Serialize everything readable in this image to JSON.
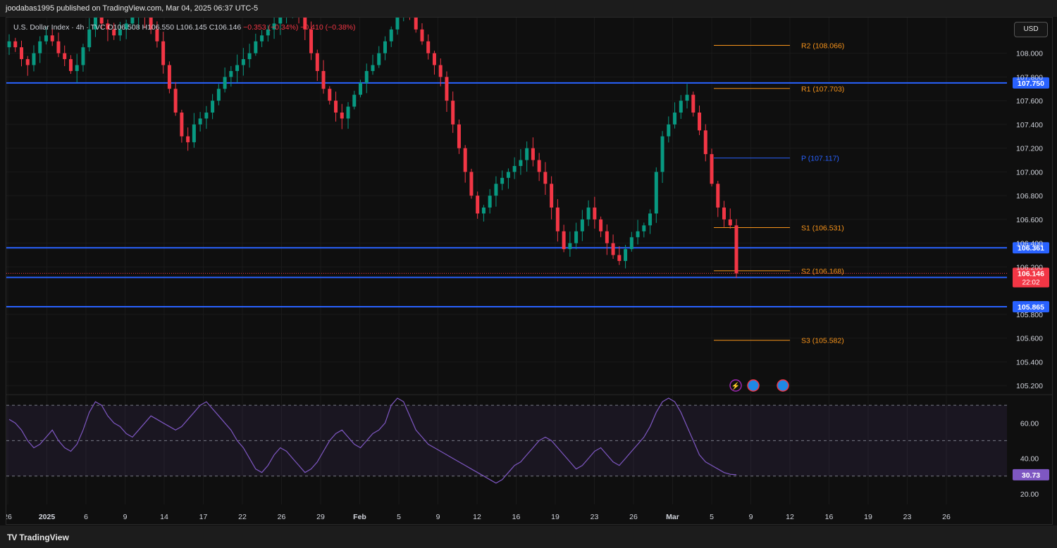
{
  "header": {
    "published": "joodabas1995 published on TradingView.com, Mar 04, 2025 06:37 UTC-5"
  },
  "legend": {
    "symbol": "U.S. Dollar Index · 4h · TVC",
    "o": "O106.508",
    "h": "H106.550",
    "l": "L106.145",
    "c": "C106.146",
    "change": "−0.353 (−0.34%)  −0.410 (−0.38%)"
  },
  "currency_button": "USD",
  "footer": {
    "logo_text": "TradingView"
  },
  "colors": {
    "up": "#089981",
    "down": "#f23645",
    "level": "#2962ff",
    "pivot_orange": "#f7931a",
    "pivot_blue": "#2962ff",
    "rsi": "#7e57c2"
  },
  "chart_data": {
    "type": "candlestick",
    "price_axis": {
      "ylim": [
        105.13,
        108.3
      ],
      "ticks": [
        "108.000",
        "107.800",
        "107.600",
        "107.400",
        "107.200",
        "107.000",
        "106.800",
        "106.600",
        "106.400",
        "106.200",
        "105.800",
        "105.600",
        "105.400",
        "105.200"
      ]
    },
    "x_ticks": [
      "26",
      "2025",
      "6",
      "9",
      "14",
      "17",
      "22",
      "26",
      "29",
      "Feb",
      "5",
      "9",
      "12",
      "16",
      "19",
      "23",
      "26",
      "Mar",
      "5",
      "9",
      "12",
      "16",
      "19",
      "23",
      "26"
    ],
    "last_price": {
      "value": "106.146",
      "countdown": "22:02"
    },
    "horizontal_levels": [
      {
        "value": 107.75,
        "label": "107.750"
      },
      {
        "value": 106.361,
        "label": "106.361"
      },
      {
        "value": 106.111,
        "label": "106.111"
      },
      {
        "value": 105.865,
        "label": "105.865"
      }
    ],
    "pivots": [
      {
        "name": "R2",
        "value": 108.066,
        "label": "R2 (108.066)"
      },
      {
        "name": "R1",
        "value": 107.703,
        "label": "R1 (107.703)"
      },
      {
        "name": "P",
        "value": 107.117,
        "label": "P (107.117)"
      },
      {
        "name": "S1",
        "value": 106.531,
        "label": "S1 (106.531)"
      },
      {
        "name": "S2",
        "value": 106.168,
        "label": "S2 (106.168)"
      },
      {
        "name": "S3",
        "value": 105.582,
        "label": "S3 (105.582)"
      }
    ],
    "closes_approx": [
      108.1,
      108.05,
      107.95,
      107.9,
      108.0,
      108.1,
      108.15,
      108.1,
      108.0,
      107.95,
      107.85,
      107.9,
      108.05,
      108.2,
      108.3,
      108.25,
      108.2,
      108.15,
      108.2,
      108.25,
      108.3,
      108.35,
      108.3,
      108.2,
      108.1,
      107.9,
      107.7,
      107.5,
      107.3,
      107.25,
      107.4,
      107.45,
      107.5,
      107.6,
      107.7,
      107.8,
      107.85,
      107.9,
      107.95,
      108.0,
      108.1,
      108.15,
      108.2,
      108.25,
      108.3,
      108.35,
      108.4,
      108.35,
      108.2,
      108.0,
      107.85,
      107.7,
      107.6,
      107.5,
      107.45,
      107.55,
      107.65,
      107.75,
      107.85,
      107.9,
      108.0,
      108.1,
      108.2,
      108.3,
      108.35,
      108.3,
      108.2,
      108.1,
      108.0,
      107.9,
      107.8,
      107.6,
      107.4,
      107.2,
      107.0,
      106.8,
      106.65,
      106.7,
      106.8,
      106.9,
      106.95,
      107.0,
      107.05,
      107.1,
      107.2,
      107.1,
      107.0,
      106.9,
      106.7,
      106.5,
      106.35,
      106.4,
      106.5,
      106.6,
      106.7,
      106.6,
      106.5,
      106.4,
      106.3,
      106.25,
      106.35,
      106.45,
      106.5,
      106.55,
      106.65,
      107.0,
      107.3,
      107.4,
      107.5,
      107.6,
      107.65,
      107.5,
      107.35,
      107.15,
      106.9,
      106.7,
      106.6,
      106.55,
      106.146
    ],
    "rsi": {
      "label": "30.73",
      "value": 30.73,
      "ylim": [
        14,
        76
      ],
      "ticks": [
        "60.00",
        "40.00",
        "20.00"
      ],
      "bands": [
        70,
        50,
        30
      ],
      "values_approx": [
        62,
        60,
        56,
        50,
        46,
        48,
        52,
        56,
        50,
        46,
        44,
        48,
        56,
        66,
        72,
        70,
        64,
        60,
        58,
        54,
        52,
        56,
        60,
        64,
        62,
        60,
        58,
        56,
        58,
        62,
        66,
        70,
        72,
        68,
        64,
        60,
        56,
        50,
        46,
        40,
        34,
        32,
        36,
        42,
        46,
        44,
        40,
        36,
        32,
        34,
        38,
        44,
        50,
        54,
        56,
        52,
        48,
        46,
        50,
        54,
        56,
        60,
        70,
        74,
        72,
        64,
        56,
        52,
        48,
        46,
        44,
        42,
        40,
        38,
        36,
        34,
        32,
        30,
        28,
        26,
        28,
        32,
        36,
        38,
        42,
        46,
        50,
        52,
        50,
        46,
        42,
        38,
        34,
        36,
        40,
        44,
        46,
        42,
        38,
        36,
        40,
        44,
        48,
        52,
        58,
        66,
        72,
        74,
        72,
        66,
        58,
        50,
        42,
        38,
        36,
        34,
        32,
        31,
        30.73
      ]
    }
  }
}
